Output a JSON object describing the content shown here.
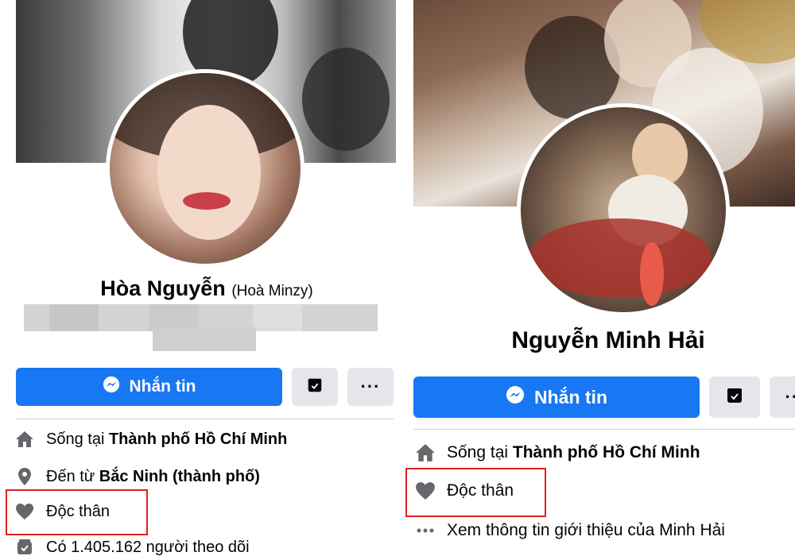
{
  "left_profile": {
    "name": "Hòa Nguyễn",
    "alternate_name": "(Hoà Minzy)",
    "message_button_label": "Nhắn tin",
    "more_label": "···",
    "info": [
      {
        "icon": "home-icon",
        "prefix": "Sống tại ",
        "bold": "Thành phố Hồ Chí Minh"
      },
      {
        "icon": "location-pin-icon",
        "prefix": "Đến từ ",
        "bold": "Bắc Ninh (thành phố)"
      },
      {
        "icon": "heart-icon",
        "prefix": "Độc thân",
        "bold": ""
      },
      {
        "icon": "followers-icon",
        "prefix": "Có 1.405.162 người theo dõi",
        "bold": ""
      }
    ]
  },
  "right_profile": {
    "name": "Nguyễn Minh Hải",
    "message_button_label": "Nhắn tin",
    "more_label": "···",
    "info": [
      {
        "icon": "home-icon",
        "prefix": "Sống tại ",
        "bold": "Thành phố Hồ Chí Minh"
      },
      {
        "icon": "heart-icon",
        "prefix": "Độc thân",
        "bold": ""
      },
      {
        "icon": "more-dots-icon",
        "prefix": "Xem thông tin giới thiệu của Minh Hải",
        "bold": ""
      }
    ]
  },
  "colors": {
    "primary_button": "#1877f2",
    "secondary_button": "#e4e6eb",
    "highlight_border": "#e02020",
    "icon": "#65676b"
  }
}
